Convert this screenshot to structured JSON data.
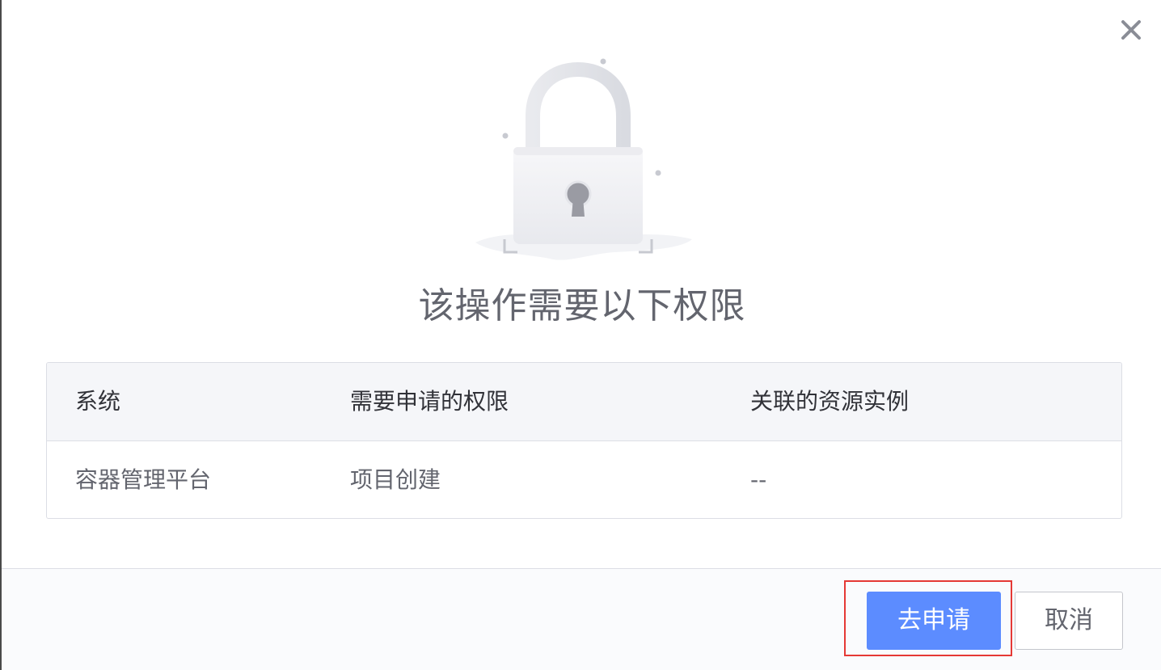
{
  "dialog": {
    "title": "该操作需要以下权限",
    "close_icon": "close-icon",
    "illustration_icon": "lock-icon"
  },
  "table": {
    "headers": [
      "系统",
      "需要申请的权限",
      "关联的资源实例"
    ],
    "rows": [
      [
        "容器管理平台",
        "项目创建",
        "--"
      ]
    ]
  },
  "footer": {
    "apply_label": "去申请",
    "cancel_label": "取消"
  },
  "colors": {
    "primary": "#5c8cff",
    "highlight": "#e53935",
    "text": "#63656e",
    "border": "#dcdee5"
  }
}
